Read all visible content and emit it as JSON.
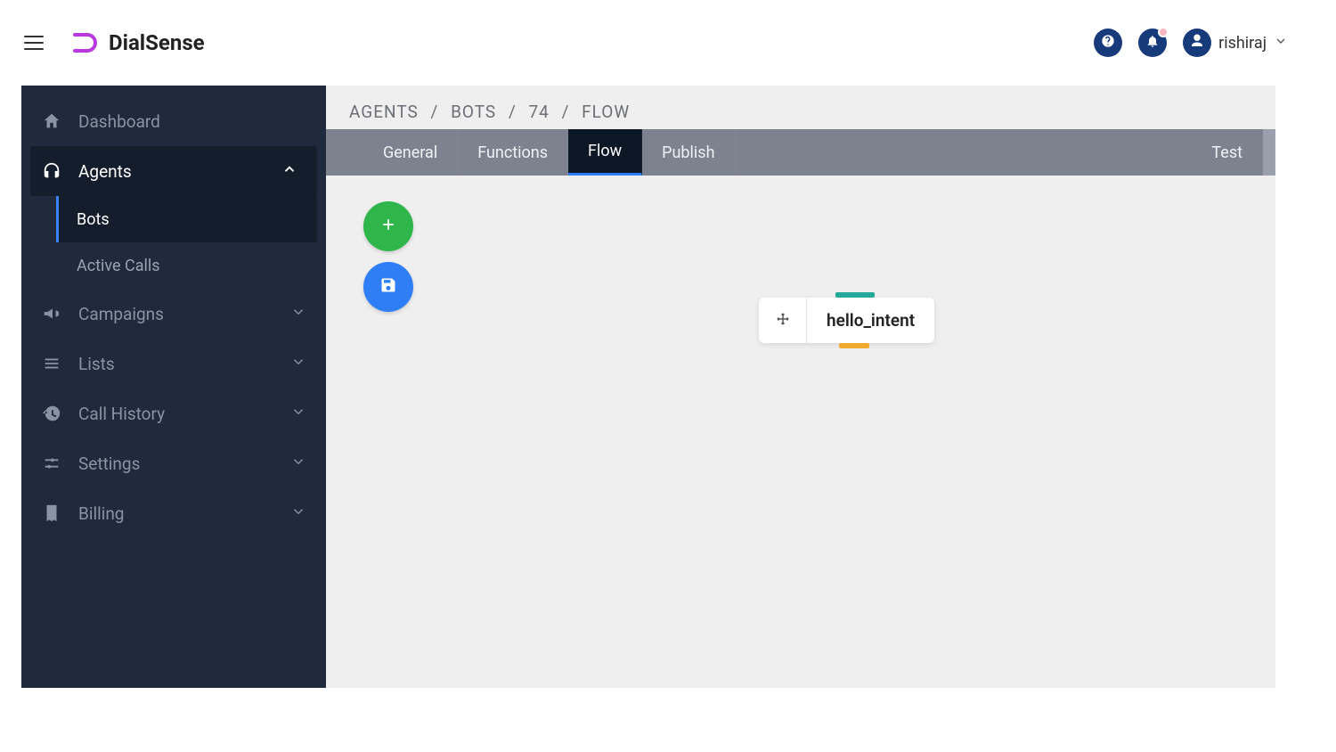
{
  "brand": {
    "name": "DialSense"
  },
  "user": {
    "name": "rishiraj"
  },
  "sidebar": {
    "items": [
      {
        "label": "Dashboard"
      },
      {
        "label": "Agents"
      },
      {
        "label": "Campaigns"
      },
      {
        "label": "Lists"
      },
      {
        "label": "Call History"
      },
      {
        "label": "Settings"
      },
      {
        "label": "Billing"
      }
    ],
    "agents_sub": [
      {
        "label": "Bots"
      },
      {
        "label": "Active Calls"
      }
    ]
  },
  "breadcrumb": {
    "parts": [
      "AGENTS",
      "BOTS",
      "74",
      "FLOW"
    ]
  },
  "tabs": {
    "items": [
      {
        "label": "General"
      },
      {
        "label": "Functions"
      },
      {
        "label": "Flow"
      },
      {
        "label": "Publish"
      }
    ],
    "right": {
      "label": "Test"
    },
    "active_index": 2
  },
  "flow": {
    "node_label": "hello_intent"
  },
  "colors": {
    "sidebar_bg": "#1f2a3c",
    "accent_blue": "#2f7ef6",
    "fab_green": "#2fb64b",
    "node_top": "#23a89b",
    "node_bottom": "#f0a92e"
  }
}
